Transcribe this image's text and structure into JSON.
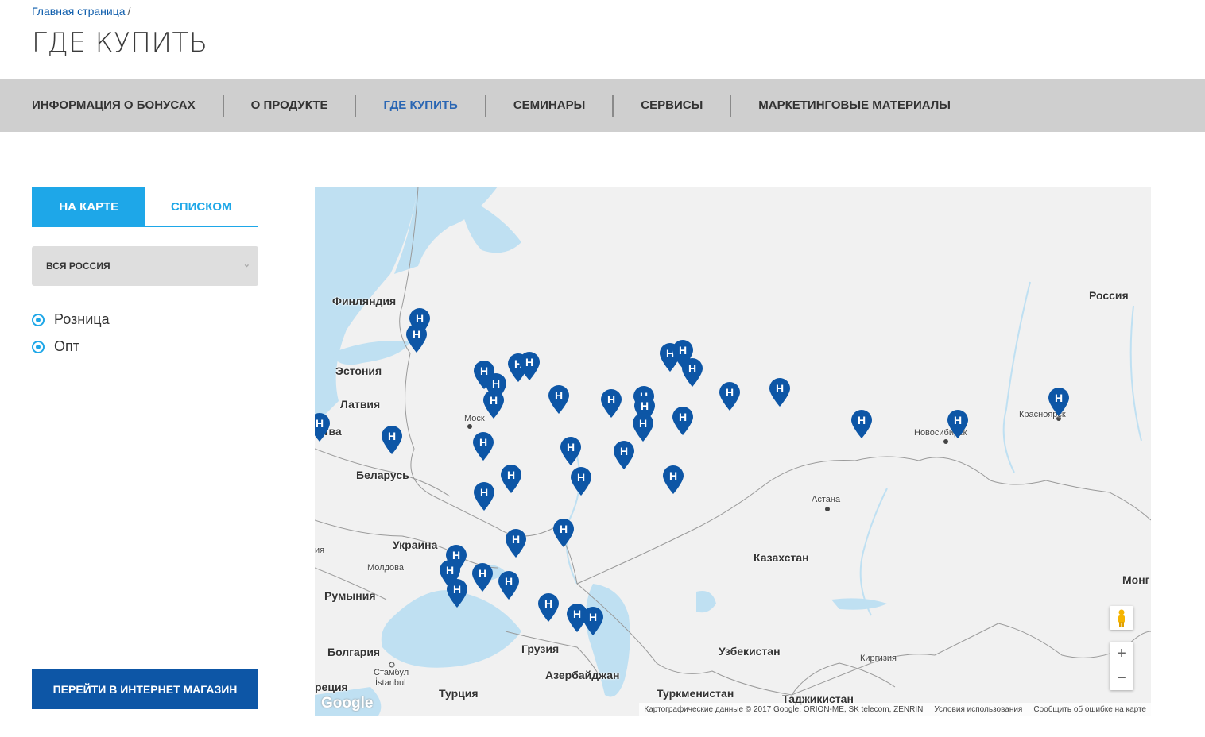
{
  "breadcrumb": {
    "home": "Главная страница",
    "separator": "/"
  },
  "page_title": "ГДЕ КУПИТЬ",
  "nav": [
    {
      "label": "ИНФОРМАЦИЯ О БОНУСАХ",
      "active": false
    },
    {
      "label": "О ПРОДУКТЕ",
      "active": false
    },
    {
      "label": "ГДЕ КУПИТЬ",
      "active": true
    },
    {
      "label": "СЕМИНАРЫ",
      "active": false
    },
    {
      "label": "СЕРВИСЫ",
      "active": false
    },
    {
      "label": "МАРКЕТИНГОВЫЕ МАТЕРИАЛЫ",
      "active": false
    }
  ],
  "view_toggle": {
    "map_label": "НА КАРТЕ",
    "list_label": "СПИСКОМ",
    "selected": "map"
  },
  "region_select": {
    "value": "ВСЯ РОССИЯ"
  },
  "filters": [
    {
      "label": "Розница",
      "checked": true
    },
    {
      "label": "Опт",
      "checked": true
    }
  ],
  "shop_button": "ПЕРЕЙТИ В ИНТЕРНЕТ МАГАЗИН",
  "map": {
    "marker_glyph": "H",
    "marker_color": "#0d56a6",
    "water_color": "#bfe0f2",
    "labels": {
      "finland": "Финляндия",
      "estonia": "Эстония",
      "latvia": "Латвия",
      "lithuania": "итва",
      "belarus": "Беларусь",
      "ukraine": "Украина",
      "moldova": "Молдова",
      "romania": "Румыния",
      "bulgaria": "Болгария",
      "greece": "реция",
      "turkey": "Турция",
      "georgia": "Грузия",
      "azerbaijan": "Азербайджан",
      "turkmenistan": "Туркменистан",
      "uzbekistan": "Узбекистан",
      "kyrgyzstan": "Киргизия",
      "tajikistan": "Таджикистан",
      "kazakhstan": "Казахстан",
      "russia": "Россия",
      "mongolia": "Монг",
      "astana": "Астана",
      "moscow": "Моск",
      "novosibirsk": "Новосибирск",
      "krasnoyarsk": "Красноярск",
      "istanbul_ru": "Стамбул",
      "istanbul_tr": "İstanbul",
      "edge_ro": "ия"
    },
    "google_logo": "Google",
    "attribution": {
      "data": "Картографические данные © 2017 Google, ORION-ME, SK telecom, ZENRIN",
      "terms": "Условия использования",
      "report": "Сообщить об ошибке на карте"
    },
    "zoom_in": "+",
    "zoom_out": "−"
  }
}
